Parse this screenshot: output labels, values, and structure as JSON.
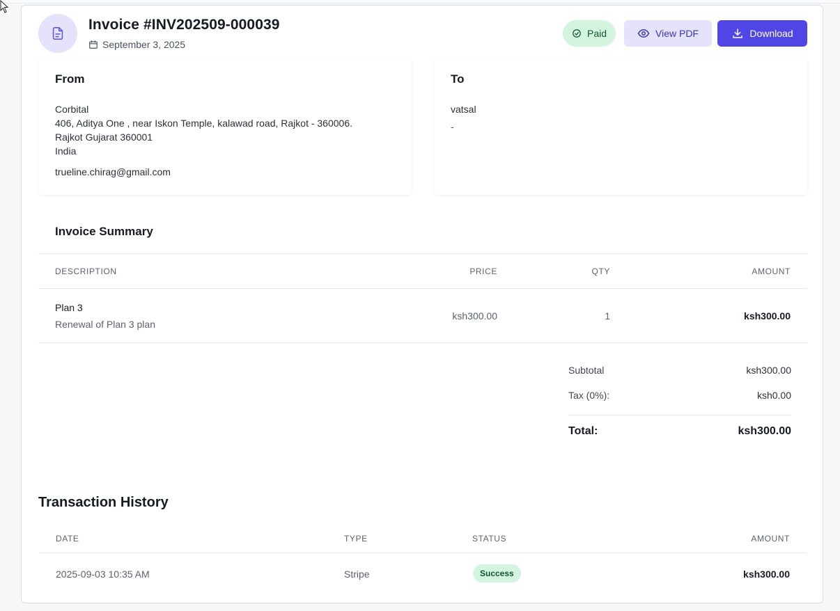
{
  "invoice": {
    "title": "Invoice #INV202509-000039",
    "date": "September 3, 2025",
    "status": "Paid"
  },
  "actions": {
    "view_pdf_label": "View PDF",
    "download_label": "Download"
  },
  "from": {
    "heading": "From",
    "name": "Corbital",
    "address1": "406, Aditya One , near Iskon Temple, kalawad road, Rajkot - 360006.",
    "address2": "Rajkot Gujarat 360001",
    "country": "India",
    "email": "trueline.chirag@gmail.com"
  },
  "to": {
    "heading": "To",
    "name": "vatsal",
    "detail": "-"
  },
  "summary": {
    "heading": "Invoice Summary",
    "columns": [
      "DESCRIPTION",
      "PRICE",
      "QTY",
      "AMOUNT"
    ],
    "items": [
      {
        "name": "Plan 3",
        "description": "Renewal of Plan 3 plan",
        "price": "ksh300.00",
        "qty": "1",
        "amount": "ksh300.00"
      }
    ],
    "subtotal_label": "Subtotal",
    "subtotal": "ksh300.00",
    "tax_label": "Tax (0%):",
    "tax": "ksh0.00",
    "total_label": "Total:",
    "total": "ksh300.00"
  },
  "transactions": {
    "heading": "Transaction History",
    "columns": [
      "DATE",
      "TYPE",
      "STATUS",
      "AMOUNT"
    ],
    "rows": [
      {
        "date": "2025-09-03 10:35 AM",
        "type": "Stripe",
        "status": "Success",
        "amount": "ksh300.00"
      }
    ]
  },
  "icons": {
    "header": "document-icon",
    "date": "calendar-icon",
    "paid": "check-circle-icon",
    "view_pdf": "eye-icon",
    "download": "download-icon"
  },
  "colors": {
    "accent": "#4f46e5",
    "accent_soft": "#e4e3fb",
    "success_bg": "#d3f5df",
    "success_text": "#14532d"
  }
}
